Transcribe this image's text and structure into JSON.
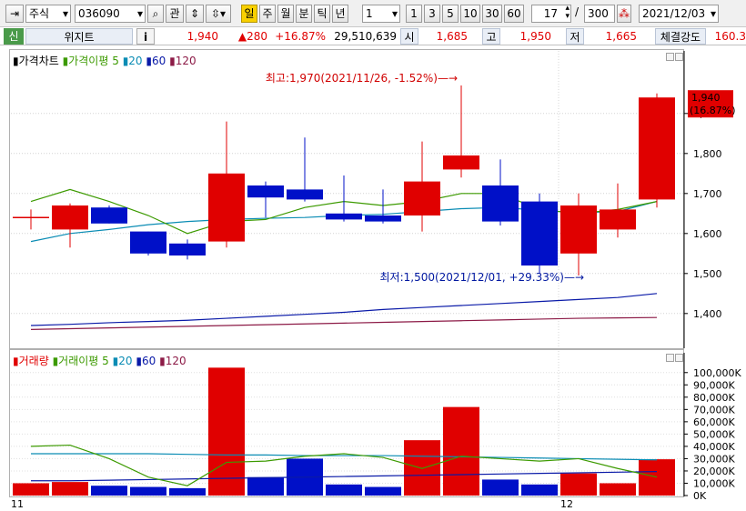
{
  "toolbar": {
    "market": "주식",
    "code": "036090",
    "btn_gwan": "관",
    "periods": [
      "일",
      "주",
      "월",
      "분",
      "틱",
      "년"
    ],
    "period_selected": "일",
    "interval_value": "1",
    "quick": [
      "1",
      "3",
      "5",
      "10",
      "30",
      "60"
    ],
    "count_value": "17",
    "count_sep": "/",
    "count_total": "300",
    "date": "2021/12/03"
  },
  "info": {
    "badge": "신",
    "name": "위지트",
    "info_btn": "i",
    "price": "1,940",
    "change": "▲280",
    "change_pct": "+16.87%",
    "volume": "29,510,639",
    "open_label": "시",
    "open": "1,685",
    "high_label": "고",
    "high": "1,950",
    "low_label": "저",
    "low": "1,665",
    "strength_label": "체결강도",
    "strength": "160.3"
  },
  "price_legend": {
    "title": "가격차트",
    "ma_label": "가격이평",
    "ma": [
      "5",
      "20",
      "60",
      "120"
    ]
  },
  "volume_legend": {
    "title": "거래량",
    "ma_label": "거래이평",
    "ma": [
      "5",
      "20",
      "60",
      "120"
    ]
  },
  "colors": {
    "up": "#e00000",
    "down": "#0010c8",
    "ma5": "#3c9a00",
    "ma20": "#0a8cb4",
    "ma60": "#0a1aa8",
    "ma120": "#8c1a46"
  },
  "chart_data": {
    "type": "candlestick",
    "price_axis": {
      "ylim": [
        1320,
        2020
      ],
      "ticks": [
        1400,
        1500,
        1600,
        1700,
        1800,
        1900
      ]
    },
    "candles": [
      {
        "o": 1640,
        "h": 1660,
        "l": 1610,
        "c": 1640
      },
      {
        "o": 1610,
        "h": 1675,
        "l": 1565,
        "c": 1670
      },
      {
        "o": 1665,
        "h": 1670,
        "l": 1625,
        "c": 1625
      },
      {
        "o": 1605,
        "h": 1605,
        "l": 1545,
        "c": 1550
      },
      {
        "o": 1575,
        "h": 1585,
        "l": 1535,
        "c": 1545
      },
      {
        "o": 1580,
        "h": 1880,
        "l": 1565,
        "c": 1750
      },
      {
        "o": 1720,
        "h": 1730,
        "l": 1640,
        "c": 1690
      },
      {
        "o": 1710,
        "h": 1840,
        "l": 1680,
        "c": 1685
      },
      {
        "o": 1650,
        "h": 1745,
        "l": 1630,
        "c": 1635
      },
      {
        "o": 1645,
        "h": 1710,
        "l": 1625,
        "c": 1630
      },
      {
        "o": 1645,
        "h": 1830,
        "l": 1605,
        "c": 1730
      },
      {
        "o": 1760,
        "h": 1970,
        "l": 1740,
        "c": 1795
      },
      {
        "o": 1720,
        "h": 1785,
        "l": 1620,
        "c": 1630
      },
      {
        "o": 1680,
        "h": 1700,
        "l": 1500,
        "c": 1520
      },
      {
        "o": 1550,
        "h": 1700,
        "l": 1495,
        "c": 1670
      },
      {
        "o": 1610,
        "h": 1725,
        "l": 1590,
        "c": 1660
      },
      {
        "o": 1685,
        "h": 1950,
        "l": 1665,
        "c": 1940
      }
    ],
    "ma5": [
      1680,
      1710,
      1680,
      1645,
      1600,
      1630,
      1635,
      1665,
      1680,
      1670,
      1680,
      1700,
      1700,
      1660,
      1650,
      1660,
      1680
    ],
    "ma20": [
      1580,
      1600,
      1610,
      1622,
      1630,
      1635,
      1638,
      1640,
      1645,
      1648,
      1655,
      1662,
      1665,
      1658,
      1652,
      1655,
      1680
    ],
    "ma60": [
      1370,
      1373,
      1377,
      1380,
      1383,
      1388,
      1393,
      1398,
      1403,
      1410,
      1415,
      1420,
      1425,
      1430,
      1435,
      1440,
      1450
    ],
    "ma120": [
      1360,
      1362,
      1364,
      1366,
      1368,
      1370,
      1372,
      1374,
      1376,
      1378,
      1380,
      1382,
      1384,
      1386,
      1388,
      1389,
      1390
    ],
    "high_annotation": "최고:1,970(2021/11/26, -1.52%)",
    "low_annotation": "최저:1,500(2021/12/01, +29.33%)",
    "last_price": "1,940",
    "last_pct": "(16.87%)",
    "volume_axis": {
      "ylim": [
        0,
        105000
      ],
      "ticks": [
        "100,000K",
        "90,000K",
        "80,000K",
        "70,000K",
        "60,000K",
        "50,000K",
        "40,000K",
        "30,000K",
        "20,000K",
        "10,000K",
        "0K"
      ]
    },
    "volumes": [
      10000,
      11000,
      8000,
      7000,
      6000,
      104000,
      15000,
      30000,
      9000,
      7000,
      45000,
      72000,
      13000,
      9000,
      18000,
      10000,
      29500
    ],
    "vma5": [
      40000,
      41000,
      30000,
      15000,
      8000,
      27000,
      28000,
      32000,
      34000,
      31000,
      22000,
      32000,
      30000,
      28000,
      30000,
      22000,
      15000
    ],
    "vma20": [
      34000,
      34000,
      34000,
      34000,
      33500,
      33000,
      33000,
      32500,
      32500,
      32500,
      32000,
      31500,
      31000,
      30500,
      30000,
      29500,
      29000
    ],
    "vma60": [
      12000,
      12000,
      12500,
      13000,
      13500,
      14000,
      14500,
      15000,
      15500,
      16000,
      16500,
      17000,
      17500,
      18000,
      18500,
      19000,
      19500
    ],
    "x_labels": [
      {
        "i": 0,
        "label": "11"
      },
      {
        "i": 14,
        "label": "12"
      }
    ]
  }
}
